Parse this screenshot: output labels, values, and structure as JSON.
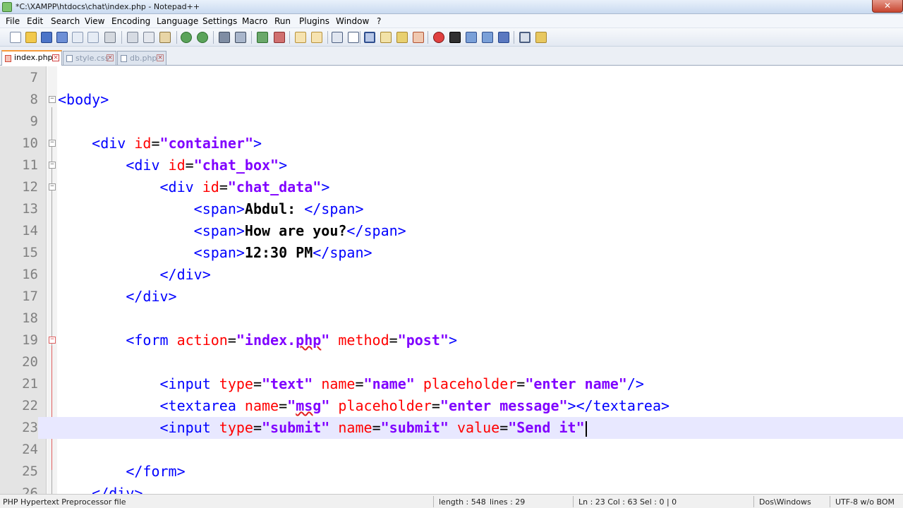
{
  "window": {
    "title": "*C:\\XAMPP\\htdocs\\chat\\index.php - Notepad++",
    "close_label": "✕"
  },
  "menu": [
    "File",
    "Edit",
    "Search",
    "View",
    "Encoding",
    "Language",
    "Settings",
    "Macro",
    "Run",
    "Plugins",
    "Window",
    "?"
  ],
  "toolbar": {
    "icons": [
      "new-file-icon",
      "open-file-icon",
      "save-icon",
      "save-all-icon",
      "close-icon",
      "close-all-icon",
      "print-icon",
      "cut-icon",
      "copy-icon",
      "paste-icon",
      "undo-icon",
      "redo-icon",
      "find-icon",
      "replace-icon",
      "zoom-in-icon",
      "zoom-out-icon",
      "sync-vertical-icon",
      "sync-horizontal-icon",
      "word-wrap-icon",
      "show-all-chars-icon",
      "indent-guide-icon",
      "user-language-icon",
      "document-map-icon",
      "function-list-icon",
      "folder-workspace-icon",
      "record-macro-icon",
      "stop-macro-icon",
      "play-macro-icon",
      "play-multiple-icon",
      "save-macro-icon",
      "spellcheck-icon",
      "plugin-icon"
    ]
  },
  "tabs": [
    {
      "label": "index.php",
      "active": true
    },
    {
      "label": "style.css",
      "active": false
    },
    {
      "label": "db.php",
      "active": false
    }
  ],
  "editor": {
    "lines": [
      {
        "num": "7",
        "tokens": []
      },
      {
        "num": "8",
        "tokens": [
          [
            "tag",
            "<body>"
          ]
        ]
      },
      {
        "num": "9",
        "tokens": []
      },
      {
        "num": "10",
        "tokens": [
          [
            "ws",
            "    "
          ],
          [
            "tag",
            "<div "
          ],
          [
            "attr",
            "id"
          ],
          [
            "eq",
            "="
          ],
          [
            "val",
            "\"container\""
          ],
          [
            "tag",
            ">"
          ]
        ]
      },
      {
        "num": "11",
        "tokens": [
          [
            "ws",
            "        "
          ],
          [
            "tag",
            "<div "
          ],
          [
            "attr",
            "id"
          ],
          [
            "eq",
            "="
          ],
          [
            "val",
            "\"chat_box\""
          ],
          [
            "tag",
            ">"
          ]
        ]
      },
      {
        "num": "12",
        "tokens": [
          [
            "ws",
            "            "
          ],
          [
            "tag",
            "<div "
          ],
          [
            "attr",
            "id"
          ],
          [
            "eq",
            "="
          ],
          [
            "val",
            "\"chat_data\""
          ],
          [
            "tag",
            ">"
          ]
        ]
      },
      {
        "num": "13",
        "tokens": [
          [
            "ws",
            "                "
          ],
          [
            "tag",
            "<span>"
          ],
          [
            "txt",
            "Abdul: "
          ],
          [
            "tag",
            "</span>"
          ]
        ]
      },
      {
        "num": "14",
        "tokens": [
          [
            "ws",
            "                "
          ],
          [
            "tag",
            "<span>"
          ],
          [
            "txt",
            "How are you?"
          ],
          [
            "tag",
            "</span>"
          ]
        ]
      },
      {
        "num": "15",
        "tokens": [
          [
            "ws",
            "                "
          ],
          [
            "tag",
            "<span>"
          ],
          [
            "txt",
            "12:30 PM"
          ],
          [
            "tag",
            "</span>"
          ]
        ]
      },
      {
        "num": "16",
        "tokens": [
          [
            "ws",
            "            "
          ],
          [
            "tag",
            "</div>"
          ]
        ]
      },
      {
        "num": "17",
        "tokens": [
          [
            "ws",
            "        "
          ],
          [
            "tag",
            "</div>"
          ]
        ]
      },
      {
        "num": "18",
        "tokens": []
      },
      {
        "num": "19",
        "tokens": [
          [
            "ws",
            "        "
          ],
          [
            "tag",
            "<form "
          ],
          [
            "attr",
            "action"
          ],
          [
            "eq",
            "="
          ],
          [
            "val",
            "\"index."
          ],
          [
            "valsq",
            "php"
          ],
          [
            "val",
            "\""
          ],
          [
            "ws",
            " "
          ],
          [
            "attr",
            "method"
          ],
          [
            "eq",
            "="
          ],
          [
            "val",
            "\"post\""
          ],
          [
            "tag",
            ">"
          ]
        ]
      },
      {
        "num": "20",
        "tokens": []
      },
      {
        "num": "21",
        "tokens": [
          [
            "ws",
            "            "
          ],
          [
            "tag",
            "<input "
          ],
          [
            "attr",
            "type"
          ],
          [
            "eq",
            "="
          ],
          [
            "val",
            "\"text\""
          ],
          [
            "ws",
            " "
          ],
          [
            "attr",
            "name"
          ],
          [
            "eq",
            "="
          ],
          [
            "val",
            "\"name\""
          ],
          [
            "ws",
            " "
          ],
          [
            "attr",
            "placeholder"
          ],
          [
            "eq",
            "="
          ],
          [
            "val",
            "\"enter name\""
          ],
          [
            "tag",
            "/>"
          ]
        ]
      },
      {
        "num": "22",
        "tokens": [
          [
            "ws",
            "            "
          ],
          [
            "tag",
            "<textarea "
          ],
          [
            "attr",
            "name"
          ],
          [
            "eq",
            "="
          ],
          [
            "val",
            "\""
          ],
          [
            "valsq",
            "msg"
          ],
          [
            "val",
            "\""
          ],
          [
            "ws",
            " "
          ],
          [
            "attr",
            "placeholder"
          ],
          [
            "eq",
            "="
          ],
          [
            "val",
            "\"enter message\""
          ],
          [
            "tag",
            "></textarea>"
          ]
        ]
      },
      {
        "num": "23",
        "tokens": [
          [
            "ws",
            "            "
          ],
          [
            "tag",
            "<input "
          ],
          [
            "attr",
            "type"
          ],
          [
            "eq",
            "="
          ],
          [
            "val",
            "\"submit\""
          ],
          [
            "ws",
            " "
          ],
          [
            "attr",
            "name"
          ],
          [
            "eq",
            "="
          ],
          [
            "val",
            "\"submit\""
          ],
          [
            "ws",
            " "
          ],
          [
            "attr",
            "value"
          ],
          [
            "eq",
            "="
          ],
          [
            "val",
            "\"Send it\""
          ],
          [
            "caret",
            ""
          ]
        ],
        "current": true
      },
      {
        "num": "24",
        "tokens": []
      },
      {
        "num": "25",
        "tokens": [
          [
            "ws",
            "        "
          ],
          [
            "tag",
            "</form>"
          ]
        ]
      },
      {
        "num": "26",
        "tokens": [
          [
            "ws",
            "    "
          ],
          [
            "tag",
            "</div>"
          ]
        ]
      }
    ]
  },
  "status": {
    "file_type": "PHP Hypertext Preprocessor file",
    "length": "length : 548",
    "lines": "lines : 29",
    "position": "Ln : 23    Col : 63    Sel : 0 | 0",
    "eol": "Dos\\Windows",
    "encoding": "UTF-8 w/o BOM"
  }
}
